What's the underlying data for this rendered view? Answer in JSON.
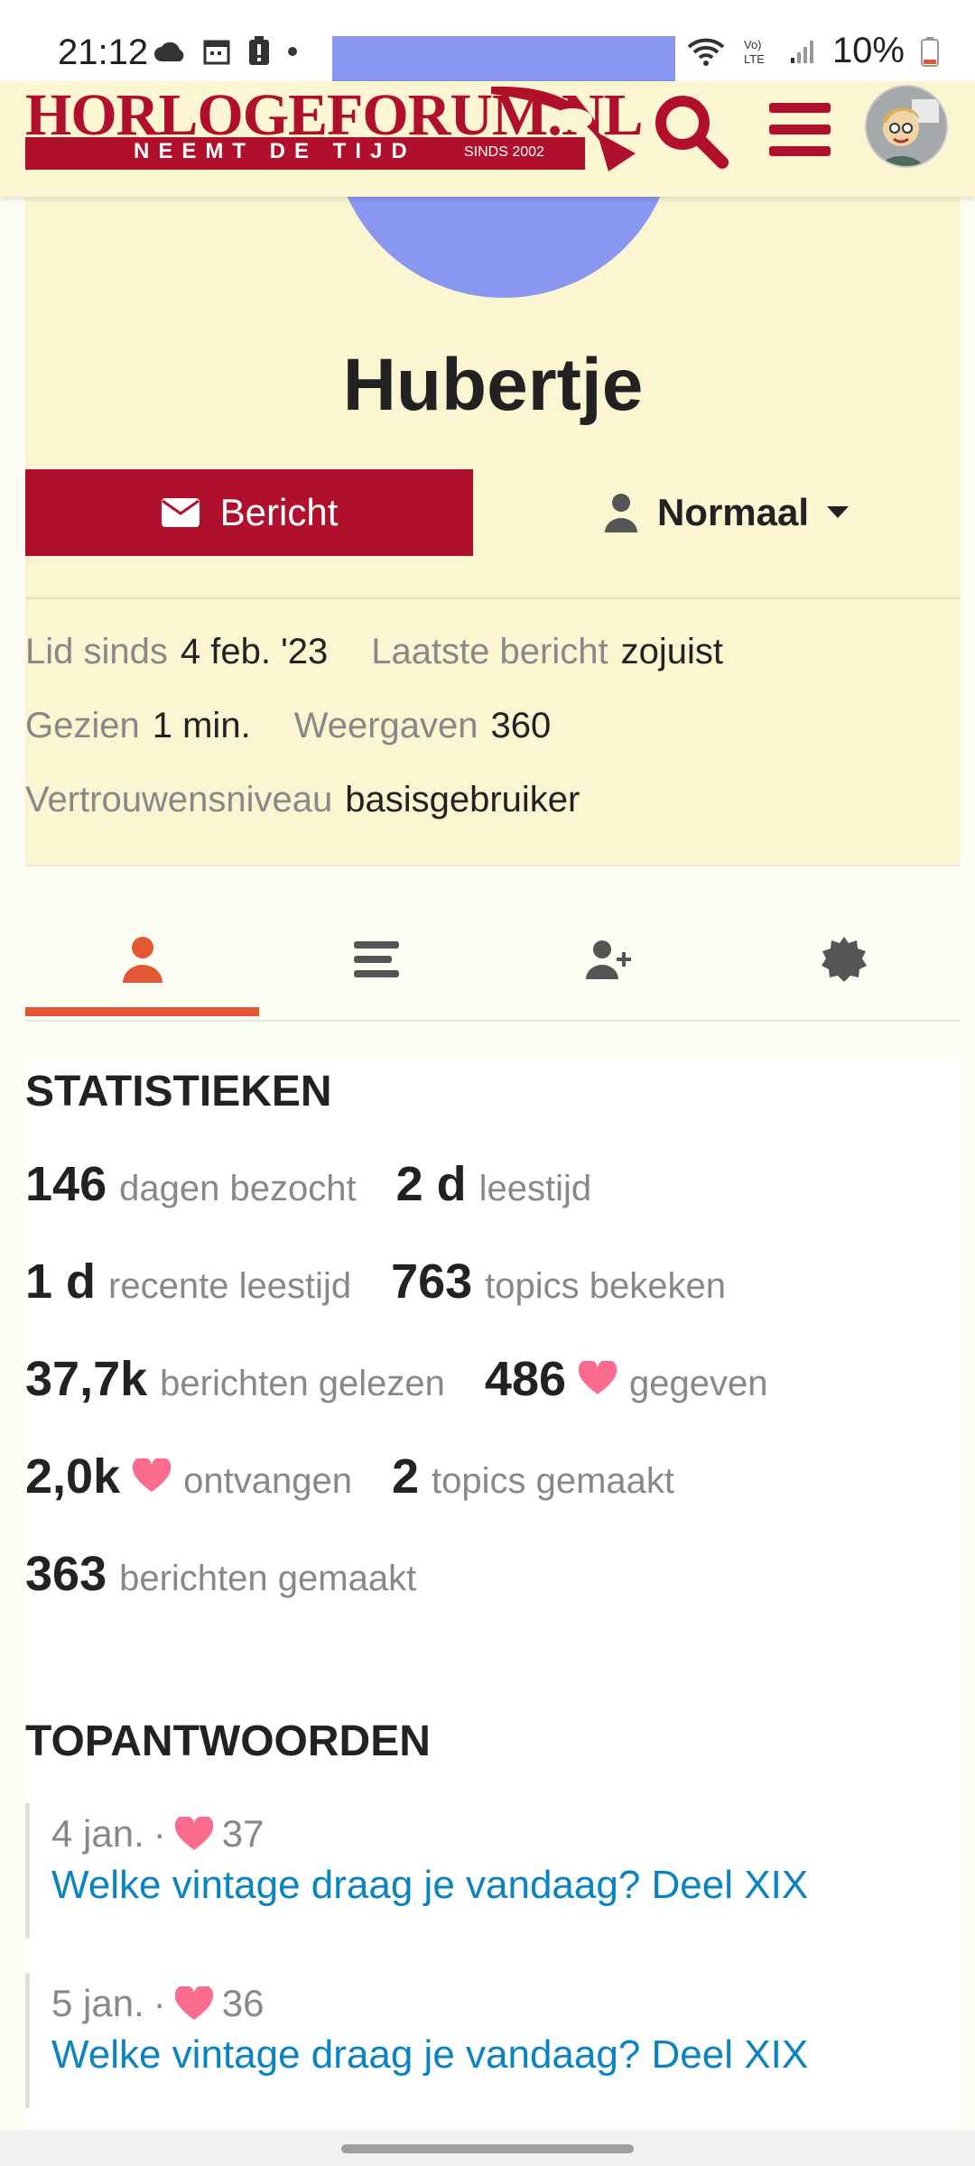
{
  "status_bar": {
    "time": "21:12",
    "battery": "10%",
    "left_icons": [
      "cloud-icon",
      "calendar-icon",
      "alert-icon",
      "dot-icon"
    ],
    "right_icons": [
      "mute-icon",
      "wifi-icon",
      "volte-icon",
      "signal-icon",
      "battery-icon"
    ]
  },
  "header": {
    "logo_text": "HORLOGEFORUM.NL",
    "logo_tagline": "NEEMT DE TIJD",
    "logo_since": "SINDS 2002",
    "brand_color": "#b0102c",
    "icons": [
      "search-icon",
      "hamburger-menu-icon",
      "user-avatar"
    ]
  },
  "profile": {
    "username": "Hubertje",
    "message_button": "Bericht",
    "notification_level": "Normaal",
    "meta": {
      "member_since_label": "Lid sinds",
      "member_since_value": "4 feb. '23",
      "last_post_label": "Laatste bericht",
      "last_post_value": "zojuist",
      "seen_label": "Gezien",
      "seen_value": "1 min.",
      "views_label": "Weergaven",
      "views_value": "360",
      "trust_label": "Vertrouwensniveau",
      "trust_value": "basisgebruiker"
    }
  },
  "tabs": [
    {
      "icon": "user-icon",
      "active": true
    },
    {
      "icon": "list-icon",
      "active": false
    },
    {
      "icon": "user-plus-icon",
      "active": false
    },
    {
      "icon": "badge-icon",
      "active": false
    }
  ],
  "stats": {
    "title": "STATISTIEKEN",
    "days_visited_num": "146",
    "days_visited_txt": "dagen bezocht",
    "read_time_num": "2 d",
    "read_time_txt": "leestijd",
    "recent_read_num": "1 d",
    "recent_read_txt": "recente leestijd",
    "topics_viewed_num": "763",
    "topics_viewed_txt": "topics bekeken",
    "posts_read_num": "37,7k",
    "posts_read_txt": "berichten gelezen",
    "likes_given_num": "486",
    "likes_given_txt": "gegeven",
    "likes_received_num": "2,0k",
    "likes_received_txt": "ontvangen",
    "topics_created_num": "2",
    "topics_created_txt": "topics gemaakt",
    "posts_created_num": "363",
    "posts_created_txt": "berichten gemaakt"
  },
  "top_replies": {
    "title": "TOPANTWOORDEN",
    "items": [
      {
        "date": "4 jan.",
        "sep": "·",
        "likes": "37",
        "topic": "Welke vintage draag je vandaag? Deel XIX"
      },
      {
        "date": "5 jan.",
        "sep": "·",
        "likes": "36",
        "topic": "Welke vintage draag je vandaag? Deel XIX"
      }
    ]
  }
}
